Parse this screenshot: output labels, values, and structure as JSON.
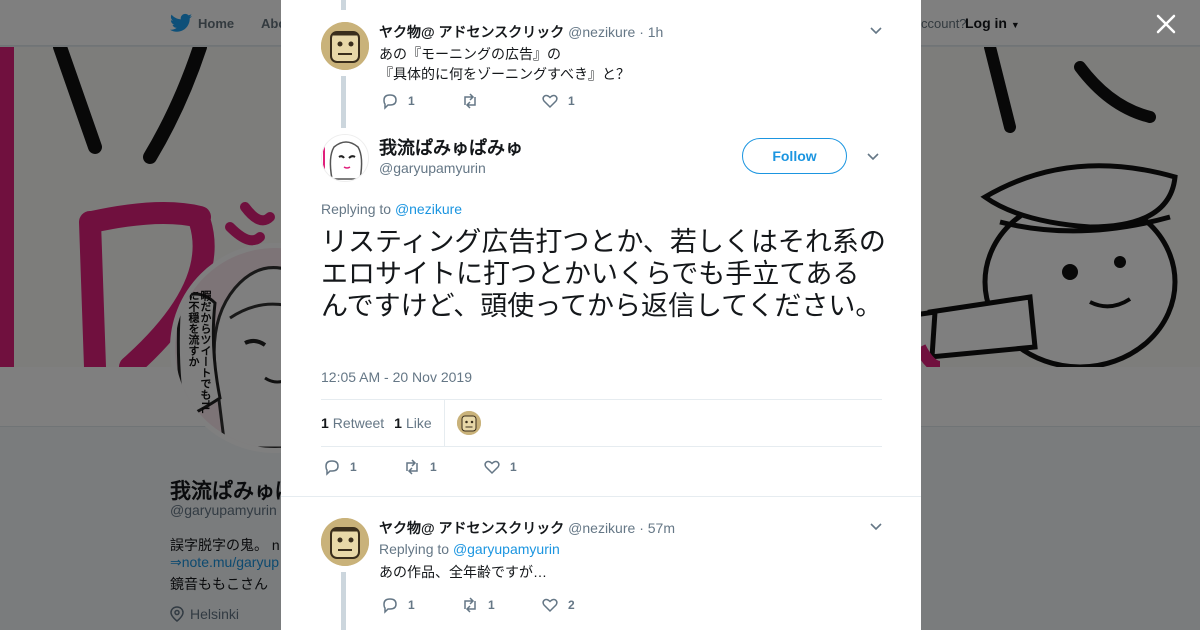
{
  "nav": {
    "home": "Home",
    "about": "Abo",
    "account": "ccount?",
    "login": "Log in"
  },
  "background_profile": {
    "name": "我流ぱみゅぱ",
    "handle": "@garyupamyurin",
    "bio_line1": "誤字脱字の鬼。 n",
    "link": "⇒note.mu/garyup",
    "bio_line2": "鏡音ももこさん",
    "location": "Helsinki",
    "avatar_speech": "暇だからツイートでもTLに不穏を流すか"
  },
  "thread": {
    "parent": {
      "name": "ヤク物@ アドセンスクリック",
      "handle": "@nezikure",
      "time": "1h",
      "text_line1": "あの『モーニングの広告』の",
      "text_line2": "『具体的に何をゾーニングすべき』と？",
      "replies": "1",
      "retweets": "",
      "likes": "1"
    },
    "main": {
      "name": "我流ぱみゅぱみゅ",
      "handle": "@garyupamyurin",
      "follow_label": "Follow",
      "replying_prefix": "Replying to",
      "replying_to": "@nezikure",
      "text": "リスティング広告打つとか、若しくはそれ系のエロサイトに打つとかいくらでも手立てあるんですけど、頭使ってから返信してください。",
      "timestamp": "12:05 AM - 20 Nov 2019",
      "retweet_count": "1",
      "retweet_label": "Retweet",
      "like_count": "1",
      "like_label": "Like",
      "replies": "1",
      "retweets": "1",
      "likes": "1"
    },
    "reply": {
      "name": "ヤク物@ アドセンスクリック",
      "handle": "@nezikure",
      "time": "57m",
      "replying_prefix": "Replying to",
      "replying_to": "@garyupamyurin",
      "text": "あの作品、全年齢ですが…",
      "replies": "1",
      "retweets": "1",
      "likes": "2"
    }
  },
  "colors": {
    "accent": "#1b95e0",
    "banner_pink": "#e0207c"
  }
}
